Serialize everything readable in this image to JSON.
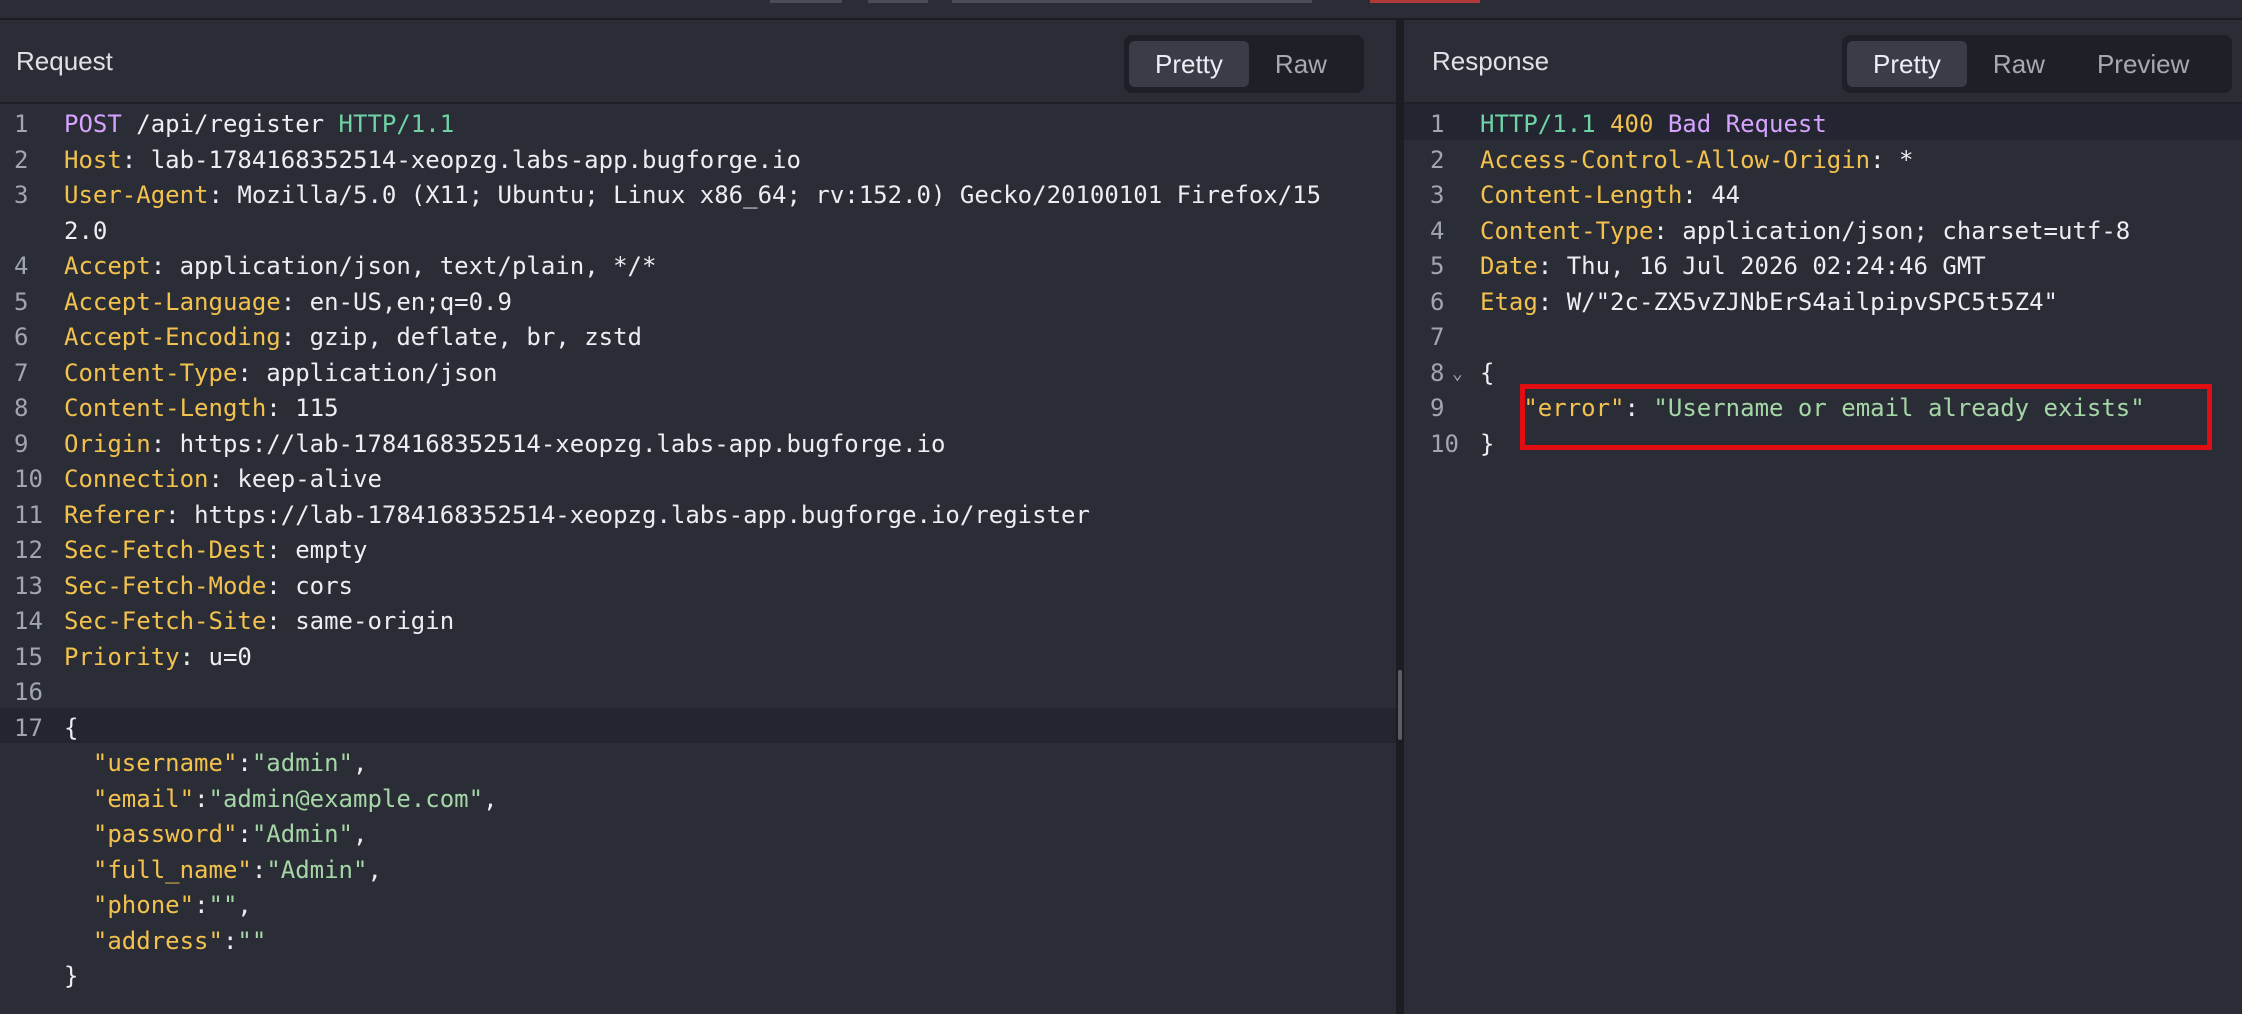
{
  "request": {
    "title": "Request",
    "tabs": [
      "Pretty",
      "Raw"
    ],
    "active_tab": "Pretty",
    "request_line": {
      "method": "POST",
      "path": "/api/register",
      "protocol": "HTTP/1.1"
    },
    "headers": [
      {
        "n": "2",
        "name": "Host",
        "value": "lab-1784168352514-xeopzg.labs-app.bugforge.io"
      },
      {
        "n": "3",
        "name": "User-Agent",
        "value": "Mozilla/5.0 (X11; Ubuntu; Linux x86_64; rv:152.0) Gecko/20100101 Firefox/15"
      },
      {
        "n": "",
        "name": "",
        "value": "2.0"
      },
      {
        "n": "4",
        "name": "Accept",
        "value": "application/json, text/plain, */*"
      },
      {
        "n": "5",
        "name": "Accept-Language",
        "value": "en-US,en;q=0.9"
      },
      {
        "n": "6",
        "name": "Accept-Encoding",
        "value": "gzip, deflate, br, zstd"
      },
      {
        "n": "7",
        "name": "Content-Type",
        "value": "application/json"
      },
      {
        "n": "8",
        "name": "Content-Length",
        "value": "115"
      },
      {
        "n": "9",
        "name": "Origin",
        "value": "https://lab-1784168352514-xeopzg.labs-app.bugforge.io"
      },
      {
        "n": "10",
        "name": "Connection",
        "value": "keep-alive"
      },
      {
        "n": "11",
        "name": "Referer",
        "value": "https://lab-1784168352514-xeopzg.labs-app.bugforge.io/register"
      },
      {
        "n": "12",
        "name": "Sec-Fetch-Dest",
        "value": "empty"
      },
      {
        "n": "13",
        "name": "Sec-Fetch-Mode",
        "value": "cors"
      },
      {
        "n": "14",
        "name": "Sec-Fetch-Site",
        "value": "same-origin"
      },
      {
        "n": "15",
        "name": "Priority",
        "value": "u=0"
      }
    ],
    "blank_line_number": "16",
    "body_line_number": "17",
    "body_open": "{",
    "body_fields": [
      {
        "key": "\"username\"",
        "value": "\"admin\"",
        "sep": ","
      },
      {
        "key": "\"email\"",
        "value": "\"admin@example.com\"",
        "sep": ","
      },
      {
        "key": "\"password\"",
        "value": "\"Admin\"",
        "sep": ","
      },
      {
        "key": "\"full_name\"",
        "value": "\"Admin\"",
        "sep": ","
      },
      {
        "key": "\"phone\"",
        "value": "\"\"",
        "sep": ","
      },
      {
        "key": "\"address\"",
        "value": "\"\"",
        "sep": ""
      }
    ],
    "body_close": "}"
  },
  "response": {
    "title": "Response",
    "tabs": [
      "Pretty",
      "Raw",
      "Preview"
    ],
    "active_tab": "Pretty",
    "status_line": {
      "protocol": "HTTP/1.1",
      "code": "400",
      "text": "Bad Request"
    },
    "headers": [
      {
        "n": "2",
        "name": "Access-Control-Allow-Origin",
        "value": "*"
      },
      {
        "n": "3",
        "name": "Content-Length",
        "value": "44"
      },
      {
        "n": "4",
        "name": "Content-Type",
        "value": "application/json; charset=utf-8"
      },
      {
        "n": "5",
        "name": "Date",
        "value": "Thu, 16 Jul 2026 02:24:46 GMT"
      },
      {
        "n": "6",
        "name": "Etag",
        "value": "W/\"2c-ZX5vZJNbErS4ailpipvSPC5t5Z4\""
      }
    ],
    "blank_line_number": "7",
    "body_open_line_number": "8",
    "body_open": "{",
    "error_line_number": "9",
    "error_key": "\"error\"",
    "error_value": "\"Username or email already exists\"",
    "body_close_line_number": "10",
    "body_close": "}",
    "highlight_color": "#e00d13"
  }
}
